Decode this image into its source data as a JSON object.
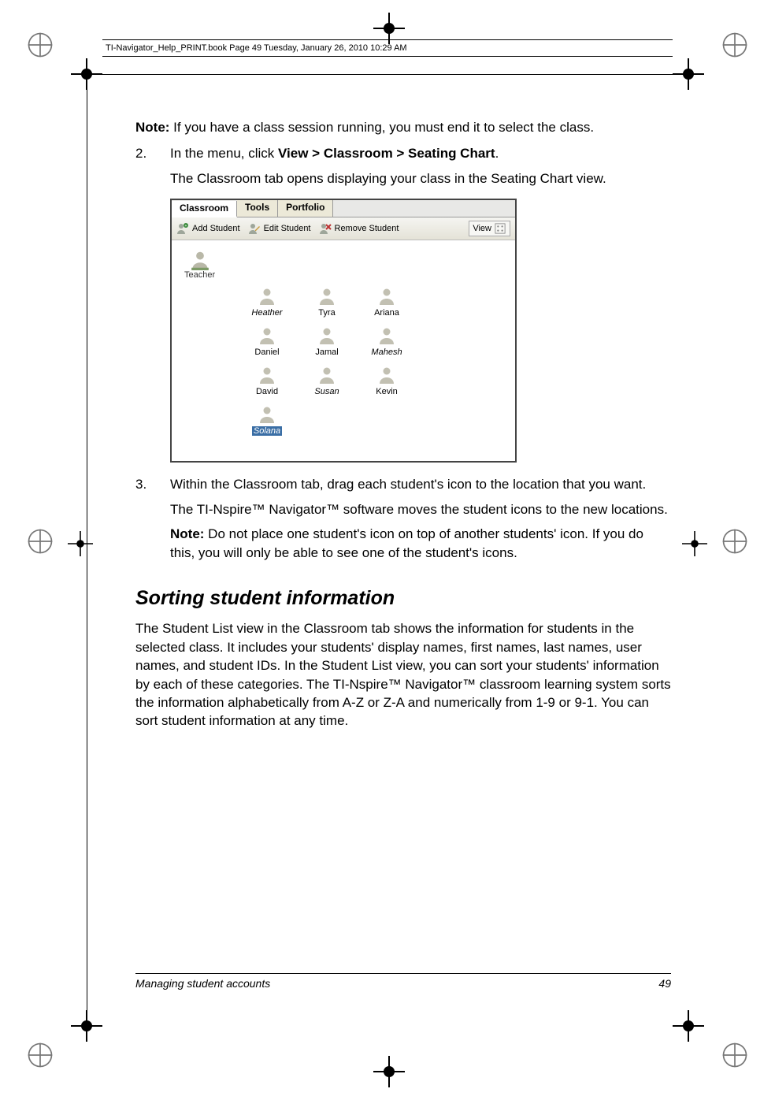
{
  "header_line": "TI-Navigator_Help_PRINT.book  Page 49  Tuesday, January 26, 2010  10:29 AM",
  "note1": {
    "prefix": "Note:",
    "text": " If you have a class session running, you must end it to select the class."
  },
  "step2": {
    "num": "2.",
    "line1_a": "In the menu, click ",
    "line1_b": "View > Classroom > Seating Chart",
    "line1_c": ".",
    "line2": "The Classroom tab opens displaying your class in the Seating Chart view."
  },
  "screenshot": {
    "tabs": [
      "Classroom",
      "Tools",
      "Portfolio"
    ],
    "active_tab_index": 0,
    "toolbar": {
      "add": "Add Student",
      "edit": "Edit Student",
      "remove": "Remove Student",
      "view": "View"
    },
    "teacher_label": "Teacher",
    "rows": [
      [
        {
          "name": "Heather",
          "italic": true
        },
        {
          "name": "Tyra"
        },
        {
          "name": "Ariana"
        }
      ],
      [
        {
          "name": "Daniel"
        },
        {
          "name": "Jamal"
        },
        {
          "name": "Mahesh",
          "italic": true
        }
      ],
      [
        {
          "name": "David"
        },
        {
          "name": "Susan",
          "italic": true
        },
        {
          "name": "Kevin"
        }
      ],
      [
        {
          "name": "Solana",
          "italic": true,
          "selected": true
        }
      ]
    ]
  },
  "step3": {
    "num": "3.",
    "line1": "Within the Classroom tab, drag each student's icon to the location that you want.",
    "line2": "The TI-Nspire™ Navigator™ software moves the student icons to the new locations.",
    "note": {
      "prefix": "Note:",
      "text": " Do not place one student's icon on top of another students' icon. If you do this, you will only be able to see one of the student's icons."
    }
  },
  "section_title": "Sorting student information",
  "section_body": "The Student List view in the Classroom tab shows the information for students in the selected class. It includes your students' display names, first names, last names, user names, and student IDs. In the Student List view, you can sort your students' information by each of these categories. The TI-Nspire™ Navigator™ classroom learning system sorts the information alphabetically from A-Z or Z-A and numerically from 1-9 or 9-1. You can sort student information at any time.",
  "footer": {
    "title": "Managing student accounts",
    "page": "49"
  }
}
